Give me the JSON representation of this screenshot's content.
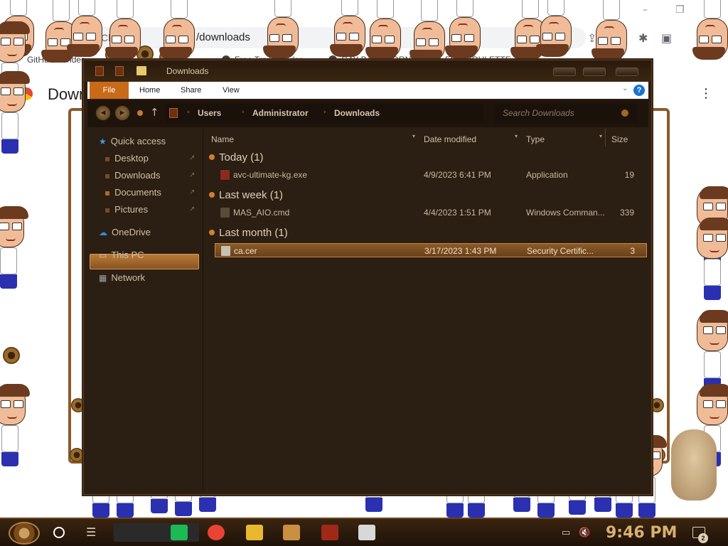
{
  "browser": {
    "site_label": "Ch",
    "url": "/downloads",
    "page_title": "Downloads",
    "window_controls": [
      "–",
      "❐"
    ],
    "bookmarks": [
      {
        "label": "GitHub - Ender"
      },
      {
        "label": "Free Transgender"
      },
      {
        "label": "GAY BARE PORN"
      },
      {
        "label": "FILE ROULETTE",
        "badge": "MF"
      }
    ],
    "kebab": "⋮",
    "toolbar_icons": [
      "⇪",
      "☆",
      "✱",
      "▣",
      "⋮"
    ]
  },
  "explorer": {
    "title": "Downloads",
    "ribbon": {
      "file": "File",
      "tabs": [
        "Home",
        "Share",
        "View"
      ],
      "help": "?",
      "collapse": "⌄"
    },
    "nav": {
      "back": "◀",
      "forward": "▶",
      "up": "↑",
      "breadcrumbs": [
        "Users",
        "Administrator",
        "Downloads"
      ],
      "separator": "›",
      "dropdown": "⌄",
      "refresh": "↻",
      "search_placeholder": "Search Downloads"
    },
    "sidebar": {
      "items": [
        {
          "label": "Quick access",
          "icon": "★",
          "color": "#3aa0e8"
        },
        {
          "label": "Desktop",
          "icon": "▪",
          "color": "#7a4a2a",
          "pinned": true
        },
        {
          "label": "Downloads",
          "icon": "▪",
          "color": "#7a4a2a",
          "pinned": true
        },
        {
          "label": "Documents",
          "icon": "▪",
          "color": "#b06a20",
          "pinned": true
        },
        {
          "label": "Pictures",
          "icon": "▪",
          "color": "#7a4a2a",
          "pinned": true
        },
        {
          "label": "OneDrive",
          "icon": "☁",
          "color": "#2a90e0"
        },
        {
          "label": "This PC",
          "icon": "▭",
          "color": "#d0c0a8"
        },
        {
          "label": "Network",
          "icon": "▦",
          "color": "#a0a0a0"
        }
      ],
      "pin_glyph": "↗"
    },
    "columns": [
      "Name",
      "Date modified",
      "Type",
      "Size"
    ],
    "groups": [
      {
        "label": "Today (1)",
        "files": [
          {
            "name": "avc-ultimate-kg.exe",
            "date": "4/9/2023 6:41 PM",
            "type": "Application",
            "size": "19",
            "icon_color": "#8a2a20"
          }
        ]
      },
      {
        "label": "Last week (1)",
        "files": [
          {
            "name": "MAS_AIO.cmd",
            "date": "4/4/2023 1:51 PM",
            "type": "Windows Comman...",
            "size": "339",
            "icon_color": "#5a4a3a"
          }
        ]
      },
      {
        "label": "Last month (1)",
        "files": [
          {
            "name": "ca.cer",
            "date": "3/17/2023 1:43 PM",
            "type": "Security Certific...",
            "size": "3",
            "icon_color": "#c8c0b0",
            "selected": true
          }
        ]
      }
    ]
  },
  "taskbar": {
    "clock": "9:46 PM",
    "notification_count": "2",
    "task_view": "☰",
    "apps": [
      {
        "name": "spotify",
        "color": "#1db954"
      },
      {
        "name": "chrome",
        "color": "#ea4335"
      },
      {
        "name": "file-explorer",
        "color": "#e8b830"
      },
      {
        "name": "media-app",
        "color": "#c89040"
      },
      {
        "name": "video-app",
        "color": "#a02818"
      },
      {
        "name": "xd-app",
        "color": "#d8d8d8"
      }
    ],
    "tray_icons": [
      "▭",
      "🔇"
    ]
  },
  "colors": {
    "accent": "#c86a18",
    "explorer_bg": "#2b1e13",
    "selection": "#8a5a2a",
    "clock": "#d8b070"
  }
}
